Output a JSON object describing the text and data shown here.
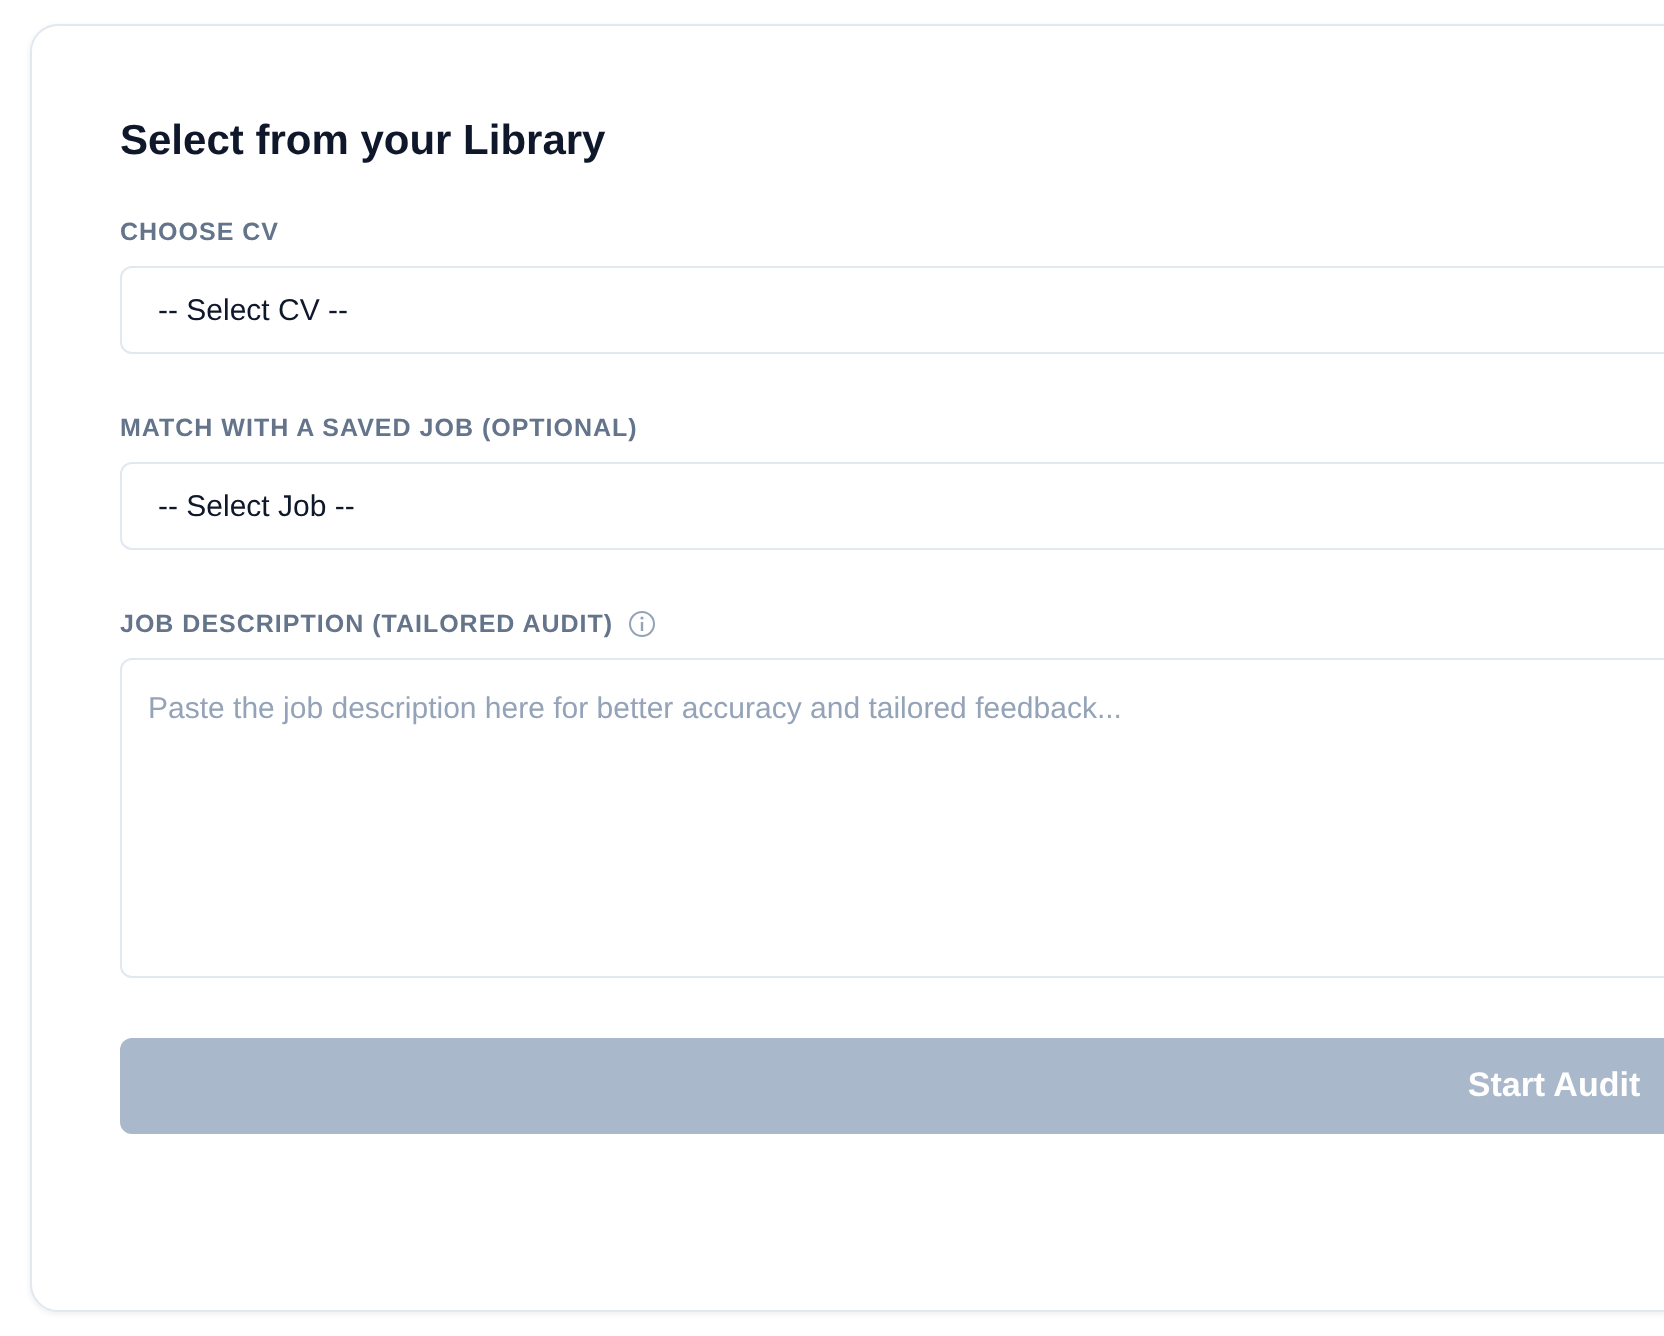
{
  "card": {
    "title": "Select from your Library",
    "fields": [
      {
        "kind": "select",
        "label": "CHOOSE CV",
        "value": "-- Select CV --",
        "info": false
      },
      {
        "kind": "select",
        "label": "MATCH WITH A SAVED JOB (OPTIONAL)",
        "value": "-- Select Job --",
        "info": false
      },
      {
        "kind": "textarea",
        "label": "JOB DESCRIPTION (TAILORED AUDIT)",
        "placeholder": "Paste the job description here for better accuracy and tailored feedback...",
        "info": true
      }
    ],
    "button": {
      "label": "Start Audit",
      "disabled": true
    }
  }
}
